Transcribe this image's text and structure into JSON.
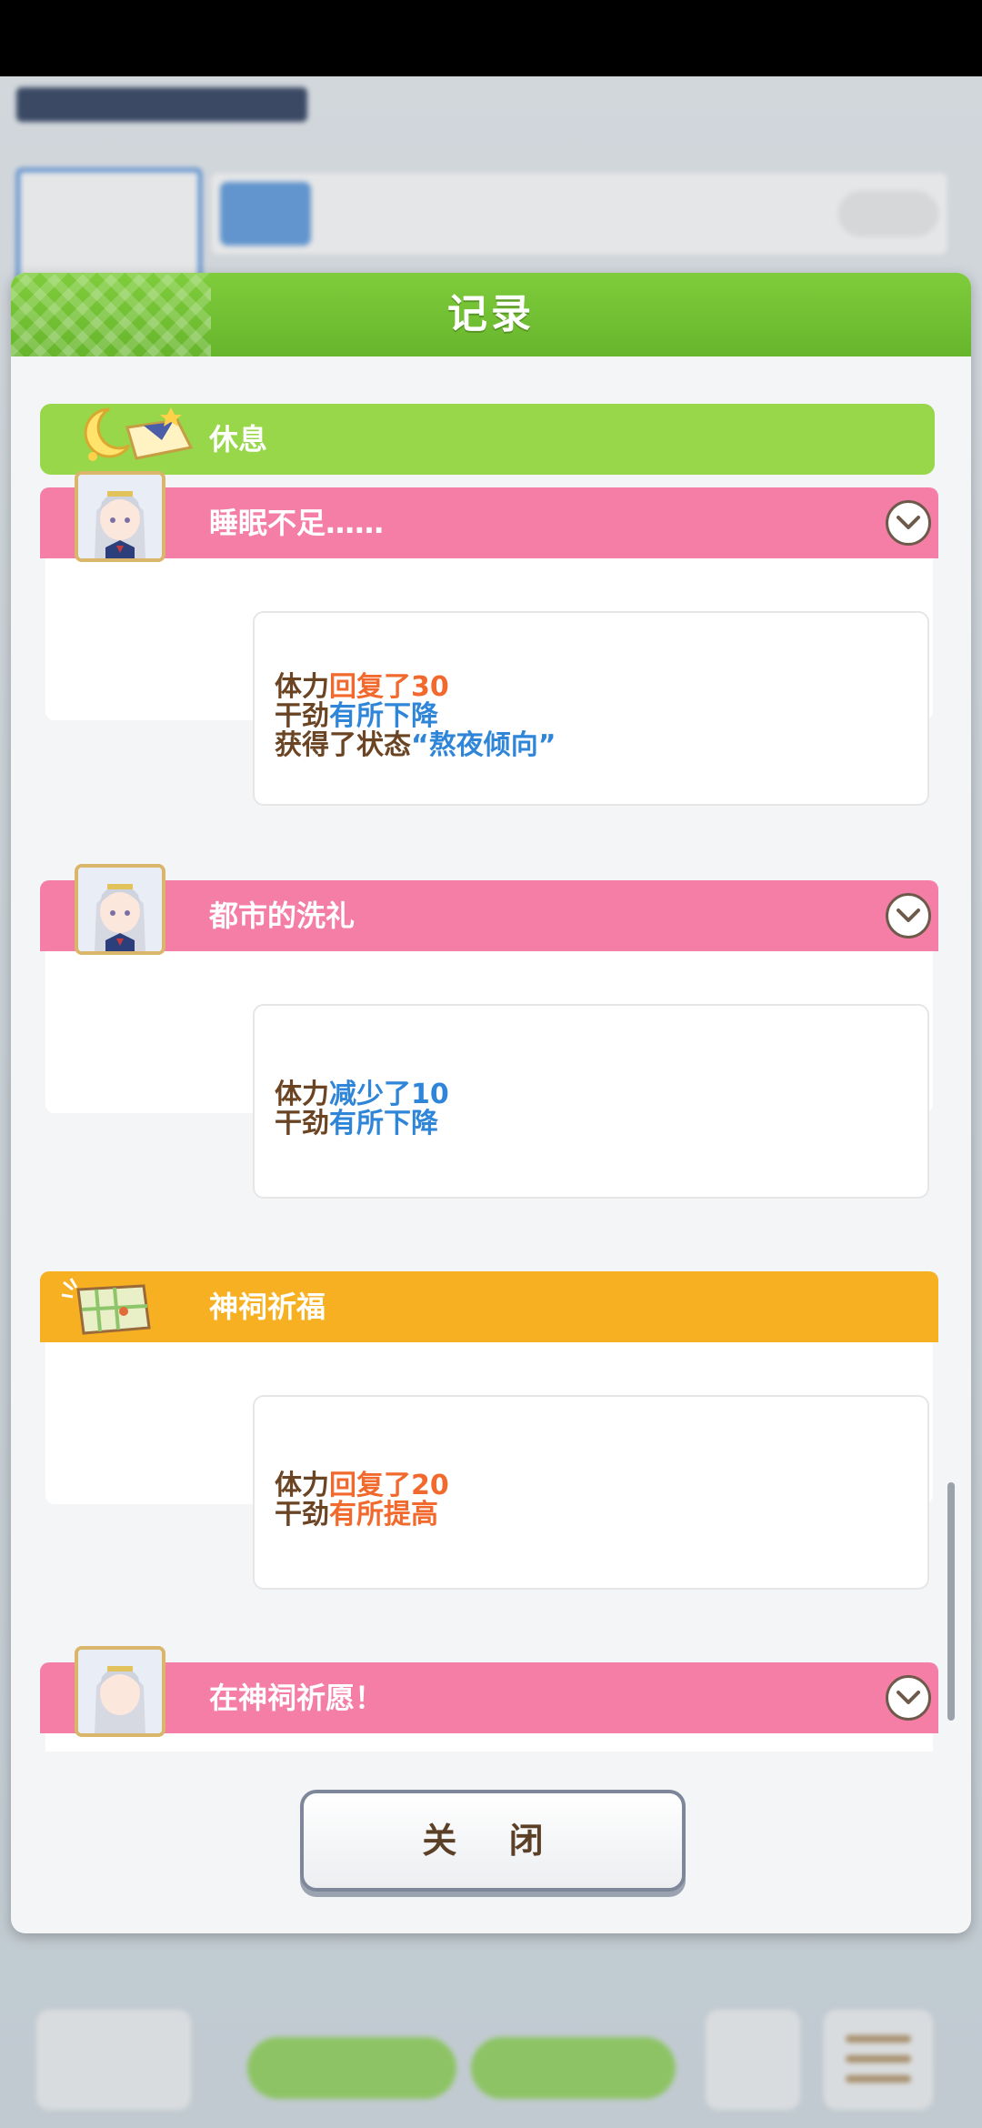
{
  "dialog": {
    "title": "记录",
    "close_label": "关 闭"
  },
  "rest": {
    "label": "休息"
  },
  "events": [
    {
      "title": "睡眠不足……",
      "lines": [
        [
          "体力",
          "回复了30"
        ],
        [
          "干劲",
          "有所下降"
        ],
        [
          "获得了状态",
          "“熬夜倾向”"
        ]
      ]
    },
    {
      "title": "都市的洗礼",
      "lines": [
        [
          "体力",
          "减少了10"
        ],
        [
          "干劲",
          "有所下降"
        ]
      ]
    },
    {
      "title": "神祠祈福",
      "lines": [
        [
          "体力",
          "回复了20"
        ],
        [
          "干劲",
          "有所提高"
        ]
      ]
    },
    {
      "title": "在神祠祈愿！"
    }
  ],
  "colors": {
    "header_green": "#6dbb30",
    "rest_green": "#98d64a",
    "event_pink": "#f57ea7",
    "event_orange": "#f7b021",
    "text_brown": "#6b4423",
    "value_orange": "#f2692e",
    "value_blue": "#2f86d8"
  },
  "icons": [
    "moon-pillow-icon",
    "character-portrait-icon",
    "map-icon",
    "chevron-down-icon"
  ]
}
